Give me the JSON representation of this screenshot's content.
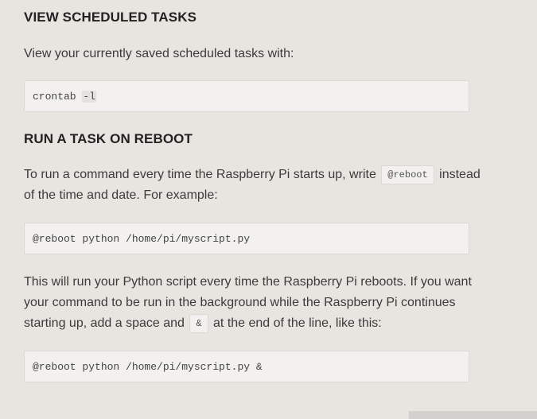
{
  "view_section": {
    "title": "VIEW SCHEDULED TASKS",
    "intro": "View your currently saved scheduled tasks with:",
    "command_base": "crontab ",
    "command_flag": "-l"
  },
  "reboot_section": {
    "title": "RUN A TASK ON REBOOT",
    "para1_before": "To run a command every time the Raspberry Pi starts up, write ",
    "para1_code": "@reboot",
    "para1_after": " instead of the time and date. For example:",
    "example1": "@reboot python /home/pi/myscript.py",
    "para2_before": "This will run your Python script every time the Raspberry Pi reboots. If you want your command to be run in the background while the Raspberry Pi continues starting up, add a space and ",
    "para2_code": "&",
    "para2_after": " at the end of the line, like this:",
    "example2": "@reboot python /home/pi/myscript.py &"
  }
}
